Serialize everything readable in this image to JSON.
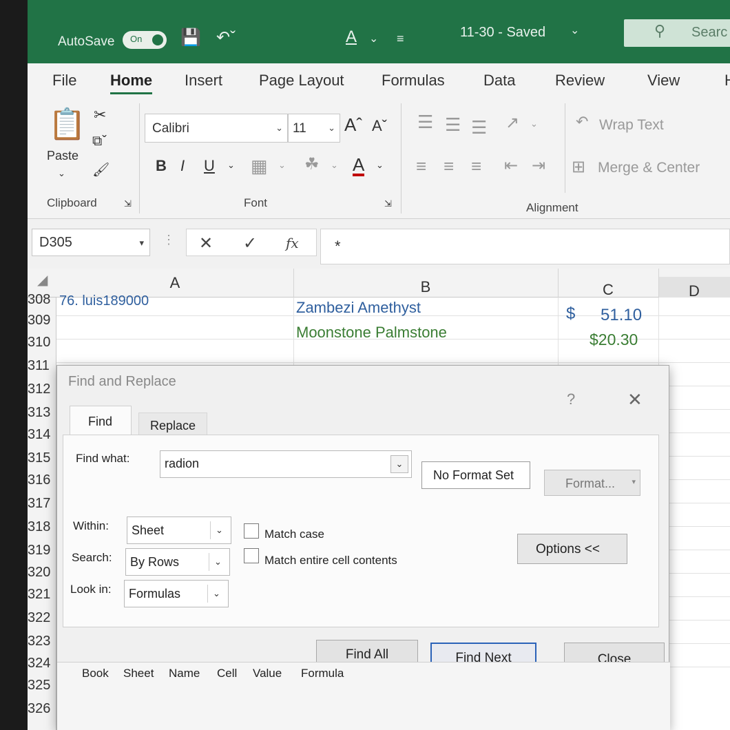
{
  "title_bar": {
    "autosave_label": "AutoSave",
    "autosave_state": "On",
    "document_title": "11-30  -  Saved",
    "title_caret": "⌄",
    "search_placeholder": "Searc"
  },
  "ribbon_tabs": [
    "File",
    "Home",
    "Insert",
    "Page Layout",
    "Formulas",
    "Data",
    "Review",
    "View",
    "H"
  ],
  "ribbon": {
    "clipboard": {
      "paste_label": "Paste",
      "group_label": "Clipboard"
    },
    "font": {
      "font_name": "Calibri",
      "font_size": "11",
      "group_label": "Font"
    },
    "alignment": {
      "wrap_text": "Wrap Text",
      "merge_center": "Merge & Center",
      "group_label": "Alignment"
    }
  },
  "formula_bar": {
    "name_box": "D305",
    "cancel_symbol": "✕",
    "enter_symbol": "✓",
    "fx_symbol": "fx",
    "formula": "*"
  },
  "grid": {
    "columns": [
      "A",
      "B",
      "C",
      "D"
    ],
    "rows": [
      "308",
      "309",
      "310",
      "311",
      "312",
      "313",
      "314",
      "315",
      "316",
      "317",
      "318",
      "319",
      "320",
      "321",
      "322",
      "323",
      "324",
      "325",
      "326"
    ],
    "cells": {
      "A308": "76. luis189000",
      "B308": "Zambezi Amethyst",
      "C308_currency": "$",
      "C308_value": "51.10",
      "B309": "Moonstone Palmstone",
      "C309": "$20.30"
    },
    "colors": {
      "blue_text": "#2f5f9e",
      "green_text": "#3a7d33"
    }
  },
  "dialog": {
    "title": "Find and Replace",
    "help": "?",
    "tabs": {
      "find": "Find",
      "replace": "Replace"
    },
    "find_what_label": "Find what:",
    "find_what_value": "radion",
    "no_format_set": "No Format Set",
    "format_button": "Format...",
    "within_label": "Within:",
    "within_value": "Sheet",
    "search_label": "Search:",
    "search_value": "By Rows",
    "look_in_label": "Look in:",
    "look_in_value": "Formulas",
    "match_case": "Match case",
    "match_entire": "Match entire cell contents",
    "options_button": "Options <<",
    "find_all": "Find All",
    "find_next": "Find Next",
    "close": "Close",
    "result_columns": [
      "Book",
      "Sheet",
      "Name",
      "Cell",
      "Value",
      "Formula"
    ]
  }
}
